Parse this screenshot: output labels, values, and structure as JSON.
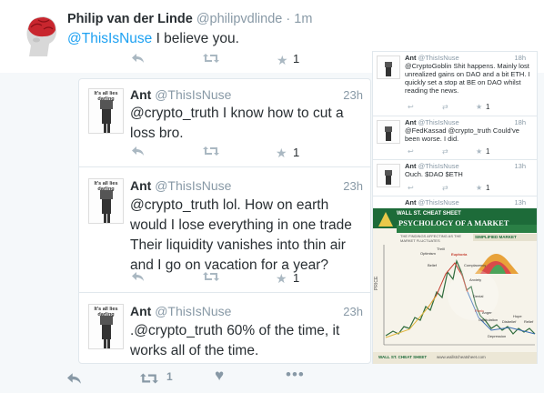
{
  "main_tweet": {
    "name": "Philip van der Linde",
    "handle": "@philipvdlinde",
    "separator": "·",
    "time": "1m",
    "mention": "@ThisIsNuse",
    "text": " I believe you.",
    "retweet_count": "1"
  },
  "thread": [
    {
      "avatar_caption": "It's all lies darling",
      "name": "Ant",
      "handle": "@ThisIsNuse",
      "time": "23h",
      "text": "@crypto_truth I know how to cut a loss bro.",
      "retweet_count": "1"
    },
    {
      "avatar_caption": "It's all lies darling",
      "name": "Ant",
      "handle": "@ThisIsNuse",
      "time": "23h",
      "text": "@crypto_truth lol. How on earth would I lose everything in one trade Their liquidity vanishes into thin air and I go on vacation for a year?",
      "retweet_count": "1"
    },
    {
      "avatar_caption": "It's all lies darling",
      "name": "Ant",
      "handle": "@ThisIsNuse",
      "time": "23h",
      "text": ".@crypto_truth 60% of the time, it works all of the time."
    }
  ],
  "right_column": [
    {
      "name": "Ant",
      "handle": "@ThisIsNuse",
      "time": "18h",
      "text": "@CryptoGoblin Shit happens. Mainly lost unrealized gains on DAO and a bit ETH. I quickly set a stop at BE on DAO whilst reading the news.",
      "retweet_count": "1"
    },
    {
      "name": "Ant",
      "handle": "@ThisIsNuse",
      "time": "18h",
      "text": "@FedKassad @crypto_truth Could've been worse. I did.",
      "retweet_count": "1"
    },
    {
      "name": "Ant",
      "handle": "@ThisIsNuse",
      "time": "13h",
      "text": "Ouch. $DAO $ETH",
      "retweet_count": "1"
    },
    {
      "name": "Ant",
      "handle": "@ThisIsNuse",
      "time": "13h"
    }
  ],
  "infographic": {
    "brand": "WALL ST. CHEAT SHEET",
    "title": "PSYCHOLOGY OF A MARKET",
    "subtitle": "THE FINDINGS AFFECTING AS THE MARKET FLUCTUATES",
    "section": "SIMPLIFIED MARKET",
    "axis_label": "PRICE",
    "phases": [
      "Optimism",
      "Belief",
      "Thrill",
      "Euphoria",
      "Complacency",
      "Anxiety",
      "Denial",
      "Panic",
      "Capitulation",
      "Anger",
      "Depression",
      "Disbelief",
      "Hope",
      "Relief"
    ],
    "footer_brand": "WALL ST. CHEAT SHEET",
    "url": "www.wallstcheatsheet.com"
  },
  "bottom_actions": {
    "retweet_count": "1"
  },
  "icons": {
    "reply": "reply-icon",
    "retweet": "retweet-icon",
    "like": "like-icon",
    "more": "more-icon"
  },
  "colors": {
    "link": "#1da1f2",
    "muted": "#8899a6",
    "text": "#292f33"
  }
}
